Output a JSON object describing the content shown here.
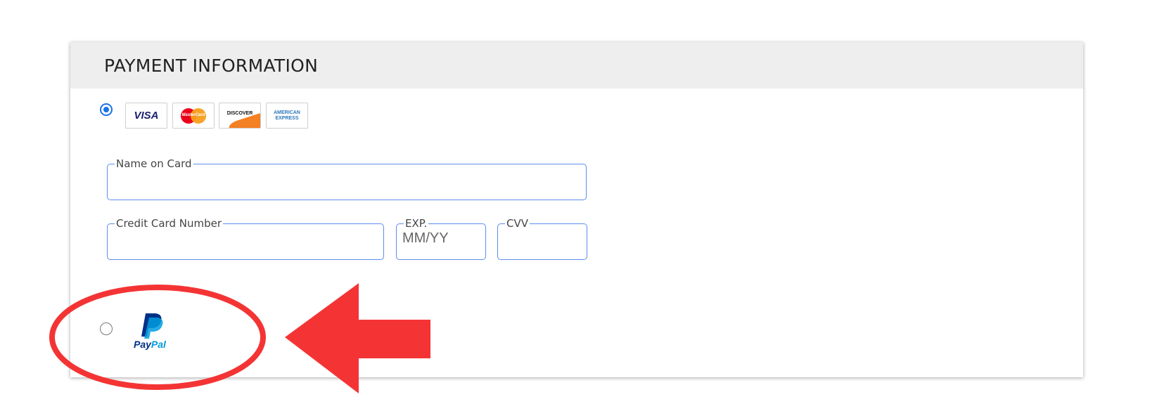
{
  "payment": {
    "title": "PAYMENT INFORMATION",
    "card_option_selected": true,
    "paypal_option_selected": false,
    "card_logos": {
      "visa": "VISA",
      "mastercard": "MasterCard",
      "discover": "DISCOVER",
      "amex_line1": "AMERICAN",
      "amex_line2": "EXPRESS"
    },
    "fields": {
      "name_on_card": {
        "label": "Name on Card",
        "value": "",
        "placeholder": ""
      },
      "card_number": {
        "label": "Credit Card Number",
        "value": "",
        "placeholder": ""
      },
      "exp": {
        "label": "EXP.",
        "value": "",
        "placeholder": "MM/YY"
      },
      "cvv": {
        "label": "CVV",
        "value": "",
        "placeholder": ""
      }
    },
    "paypal": {
      "pay": "Pay",
      "pal": "Pal"
    }
  },
  "colors": {
    "accent": "#1a73e8",
    "field_border": "#5b8def",
    "header_bg": "#eeeeee",
    "annotation_red": "#f43434",
    "paypal_dark": "#003087",
    "paypal_light": "#009cde"
  },
  "icons": {
    "annotation_circle": "red-ellipse-icon",
    "annotation_arrow": "red-left-arrow-icon"
  }
}
